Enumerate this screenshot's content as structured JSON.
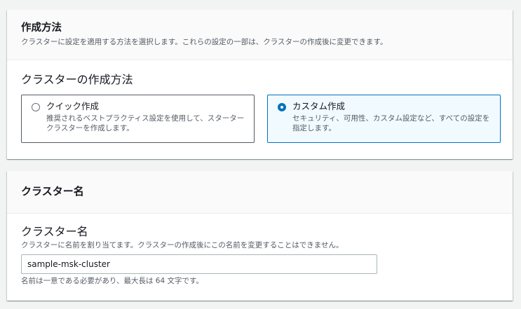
{
  "creation_method": {
    "title": "作成方法",
    "description": "クラスターに設定を適用する方法を選択します。これらの設定の一部は、クラスターの作成後に変更できます。",
    "field_label": "クラスターの作成方法",
    "options": [
      {
        "label": "クイック作成",
        "description": "推奨されるベストプラクティス設定を使用して、スターター クラスターを作成します。",
        "selected": false
      },
      {
        "label": "カスタム作成",
        "description": "セキュリティ、可用性、カスタム設定など、すべての設定を指定します。",
        "selected": true
      }
    ]
  },
  "cluster_name": {
    "title": "クラスター名",
    "field_label": "クラスター名",
    "description": "クラスターに名前を割り当てます。クラスターの作成後にこの名前を変更することはできません。",
    "value": "sample-msk-cluster",
    "constraint": "名前は一意である必要があり、最大長は 64 文字です。"
  },
  "colors": {
    "accent": "#0073bb",
    "selected_bg": "#f1faff",
    "page_bg": "#f2f3f3"
  }
}
